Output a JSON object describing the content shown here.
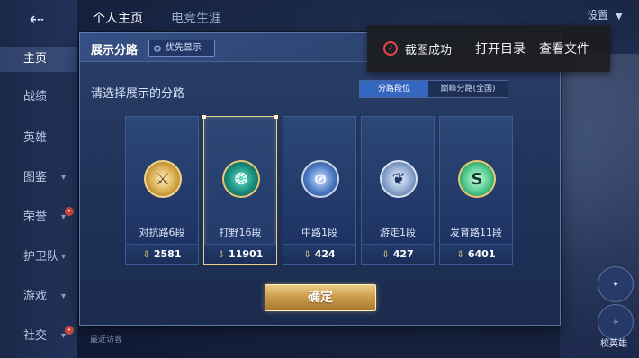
{
  "background": {
    "tabs": [
      "个人主页",
      "电竞生涯"
    ],
    "sidebar": [
      {
        "label": "主页",
        "active": true,
        "chevron": false,
        "badge": false
      },
      {
        "label": "战绩",
        "active": false,
        "chevron": false,
        "badge": false
      },
      {
        "label": "英雄",
        "active": false,
        "chevron": false,
        "badge": false
      },
      {
        "label": "图鉴",
        "active": false,
        "chevron": true,
        "badge": false
      },
      {
        "label": "荣誉",
        "active": false,
        "chevron": true,
        "badge": true
      },
      {
        "label": "护卫队",
        "active": false,
        "chevron": true,
        "badge": false
      },
      {
        "label": "游戏",
        "active": false,
        "chevron": true,
        "badge": false
      },
      {
        "label": "社交",
        "active": false,
        "chevron": true,
        "badge": true
      }
    ],
    "settings_label": "设置",
    "bottom_text": "最近访客",
    "right_label": "校英雄"
  },
  "toast": {
    "status_text": "截图成功",
    "open_folder": "打开目录",
    "view_file": "查看文件"
  },
  "dialog": {
    "title": "展示分路",
    "priority_label": "优先显示",
    "subtitle": "请选择展示的分路",
    "segments": [
      {
        "label": "分路段位",
        "active": true
      },
      {
        "label": "巅峰分路(全国)",
        "active": false
      }
    ],
    "lanes": [
      {
        "name": "对抗路6段",
        "score": "2581",
        "badge_icon": "crossed-swords-icon",
        "badge_style": "badge-gold",
        "badge_glyph": "⚔",
        "selected": false
      },
      {
        "name": "打野16段",
        "score": "11901",
        "badge_icon": "dragon-icon",
        "badge_style": "badge-teal",
        "badge_glyph": "❂",
        "selected": true
      },
      {
        "name": "中路1段",
        "score": "424",
        "badge_icon": "slash-icon",
        "badge_style": "badge-silver-blue",
        "badge_glyph": "⊘",
        "selected": false
      },
      {
        "name": "游走1段",
        "score": "427",
        "badge_icon": "wings-icon",
        "badge_style": "badge-silver",
        "badge_glyph": "❦",
        "selected": false
      },
      {
        "name": "发育路11段",
        "score": "6401",
        "badge_icon": "serpent-icon",
        "badge_style": "badge-green",
        "badge_glyph": "S",
        "selected": false
      }
    ],
    "confirm_label": "确定"
  },
  "colors": {
    "accent_gold": "#e9cc85",
    "active_segment": "#3566c0",
    "toast_icon": "#e8464b"
  }
}
